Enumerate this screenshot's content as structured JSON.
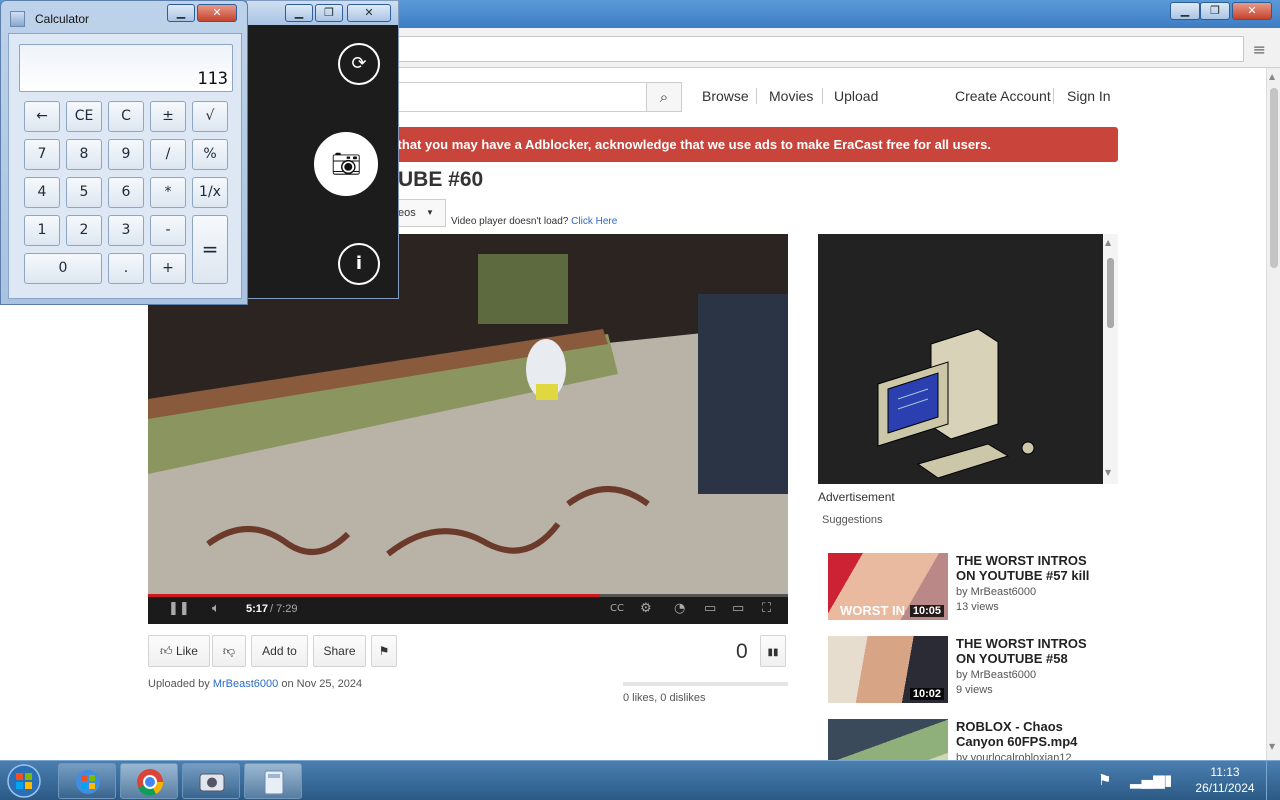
{
  "browser": {
    "menu_icon": "≡"
  },
  "site": {
    "search_placeholder": "",
    "nav": {
      "browse": "Browse",
      "movies": "Movies",
      "upload": "Upload",
      "create_account": "Create Account",
      "sign_in": "Sign In"
    },
    "adblock_banner": "d that you may have a Adblocker, acknowledge that we use ads to make EraCast free for all users.",
    "video_title": "UBE #60",
    "videos_dropdown": "eos",
    "player_help": "Video player doesn't load?",
    "player_help_link": "Click Here"
  },
  "player": {
    "time_current": "5:17",
    "time_total": "/ 7:29",
    "progress_fraction": 0.706
  },
  "actions": {
    "like": "Like",
    "add_to": "Add to",
    "share": "Share",
    "views": "0",
    "uploaded_prefix": "Uploaded by",
    "uploader": "MrBeast6000",
    "uploaded_date": "on Nov 25, 2024",
    "likes_summary": "0 likes, 0 dislikes"
  },
  "sidebar": {
    "ad_label": "Advertisement",
    "suggestions_label": "Suggestions",
    "suggestions": [
      {
        "title": "THE WORST INTROS ON YOUTUBE #57 kill",
        "by": "by MrBeast6000",
        "views": "13 views",
        "duration": "10:05",
        "thumb_text": "WORST IN"
      },
      {
        "title": "THE WORST INTROS ON YOUTUBE #58",
        "by": "by MrBeast6000",
        "views": "9 views",
        "duration": "10:02",
        "thumb_text": ""
      },
      {
        "title": "ROBLOX - Chaos Canyon 60FPS.mp4",
        "by": "by yourlocalrobloxian12",
        "views": "",
        "duration": "",
        "thumb_text": ""
      }
    ]
  },
  "calculator": {
    "title": "Calculator",
    "display": "113",
    "keys": {
      "back": "←",
      "ce": "CE",
      "c": "C",
      "plusminus": "±",
      "sqrt": "√",
      "k7": "7",
      "k8": "8",
      "k9": "9",
      "div": "/",
      "pct": "%",
      "k4": "4",
      "k5": "5",
      "k6": "6",
      "mul": "*",
      "recip": "1/x",
      "k1": "1",
      "k2": "2",
      "k3": "3",
      "minus": "-",
      "equals": "=",
      "k0": "0",
      "dot": ".",
      "plus": "+"
    }
  },
  "taskbar": {
    "time": "11:13",
    "date": "26/11/2024"
  },
  "colors": {
    "banner": "#c9443a",
    "progress": "#cc181e",
    "link": "#2a6cc4"
  }
}
